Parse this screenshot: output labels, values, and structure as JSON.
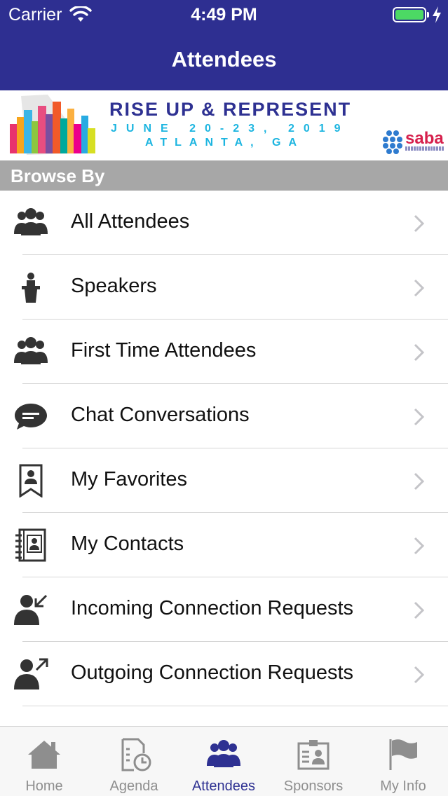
{
  "status_bar": {
    "carrier": "Carrier",
    "time": "4:49 PM"
  },
  "nav": {
    "title": "Attendees"
  },
  "banner": {
    "title": "RISE UP & REPRESENT",
    "dates": "JUNE 20-23, 2019",
    "city": "ATLANTA, GA",
    "logo_text": "saba"
  },
  "section": {
    "header": "Browse By"
  },
  "rows": [
    {
      "label": "All Attendees",
      "icon": "group-icon"
    },
    {
      "label": "Speakers",
      "icon": "podium-icon"
    },
    {
      "label": "First Time Attendees",
      "icon": "group-icon"
    },
    {
      "label": "Chat Conversations",
      "icon": "chat-bubble-icon"
    },
    {
      "label": "My Favorites",
      "icon": "bookmark-person-icon"
    },
    {
      "label": "My Contacts",
      "icon": "address-book-icon"
    },
    {
      "label": "Incoming Connection Requests",
      "icon": "person-incoming-icon"
    },
    {
      "label": "Outgoing Connection Requests",
      "icon": "person-outgoing-icon"
    }
  ],
  "tabs": [
    {
      "label": "Home",
      "icon": "home-icon",
      "active": false
    },
    {
      "label": "Agenda",
      "icon": "agenda-clock-icon",
      "active": false
    },
    {
      "label": "Attendees",
      "icon": "attendees-icon",
      "active": true
    },
    {
      "label": "Sponsors",
      "icon": "sponsors-badge-icon",
      "active": false
    },
    {
      "label": "My Info",
      "icon": "flag-icon",
      "active": false
    }
  ],
  "colors": {
    "header_bg": "#2e2f91",
    "active_tab": "#2e3192",
    "inactive_tab": "#8e8e8e",
    "section_bg": "#a7a7a7",
    "banner_title": "#2e3192",
    "banner_accent": "#1cb5e0",
    "logo_red": "#d6204c"
  }
}
